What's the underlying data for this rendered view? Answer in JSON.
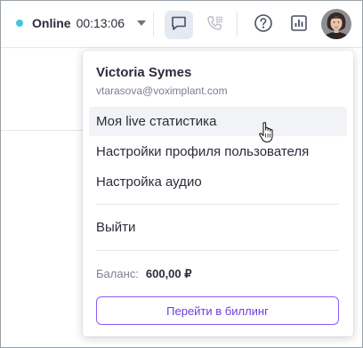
{
  "header": {
    "status_label": "Online",
    "timer": "00:13:06",
    "status_color": "#47c4dd",
    "icons": [
      "chevron-down-icon",
      "chat-icon",
      "phone-icon",
      "help-icon",
      "stats-icon"
    ]
  },
  "menu": {
    "user_name": "Victoria Symes",
    "user_email": "vtarasova@voximplant.com",
    "items": [
      {
        "label": "Моя live статистика"
      },
      {
        "label": "Настройки профиля пользователя"
      },
      {
        "label": "Настройка аудио"
      },
      {
        "label": "Выйти"
      }
    ],
    "balance_label": "Баланс:",
    "balance_value": "600,00 ₽",
    "billing_button": "Перейти в биллинг",
    "accent_color": "#8a5cf5"
  }
}
